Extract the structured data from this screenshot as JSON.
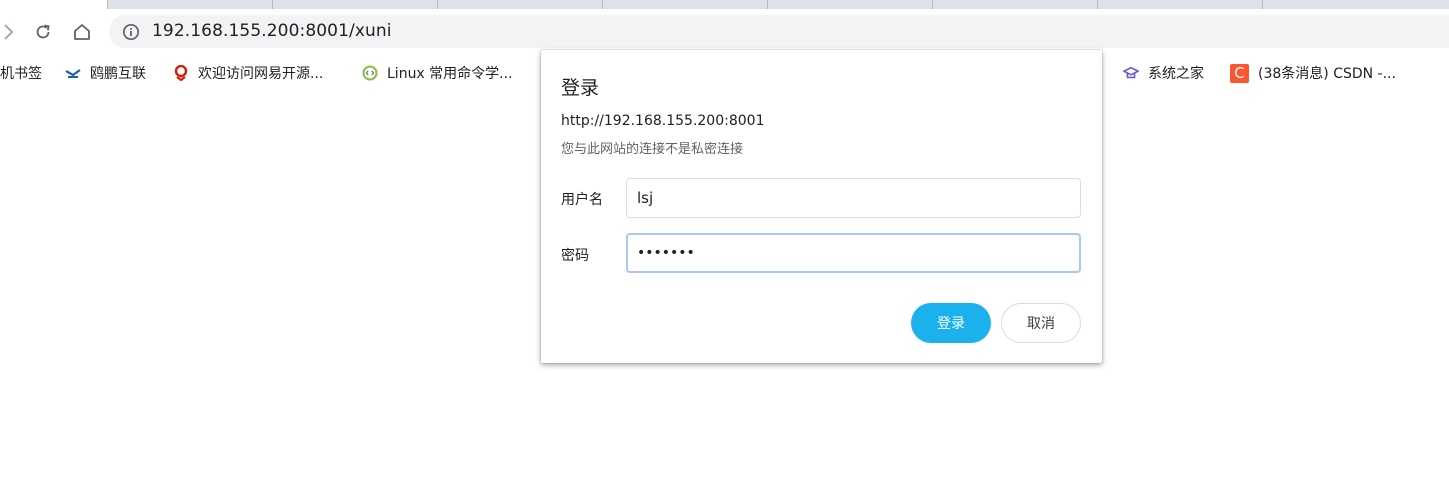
{
  "browser": {
    "url": "192.168.155.200:8001/xuni"
  },
  "bookmarks": [
    {
      "label": "机书签",
      "icon": "none"
    },
    {
      "label": "鸥鹏互联",
      "icon": "ouping-logo-icon"
    },
    {
      "label": "欢迎访问网易开源...",
      "icon": "netease-logo-icon"
    },
    {
      "label": "Linux 常用命令学...",
      "icon": "code-globe-icon"
    },
    {
      "label": "系统之家",
      "icon": "xitong-logo-icon"
    },
    {
      "label": "(38条消息) CSDN -...",
      "icon": "csdn-logo-icon"
    }
  ],
  "dialog": {
    "title": "登录",
    "origin": "http://192.168.155.200:8001",
    "warning": "您与此网站的连接不是私密连接",
    "username_label": "用户名",
    "username_value": "lsj",
    "password_label": "密码",
    "password_value": "•••••••",
    "login_button": "登录",
    "cancel_button": "取消"
  },
  "colors": {
    "primary_button": "#1ab1ec",
    "focus_ring": "#a8c7fa",
    "omnibox_bg": "#f1f3f4",
    "csdn": "#fc5531"
  }
}
